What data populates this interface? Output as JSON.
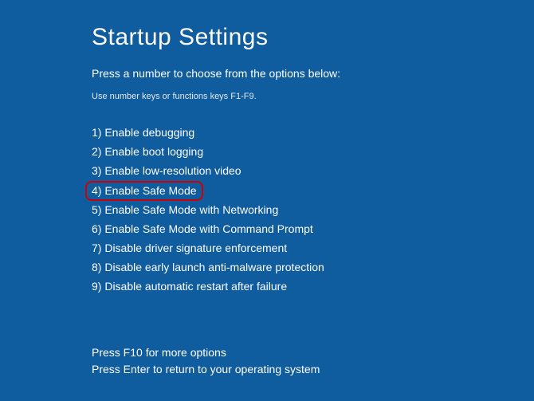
{
  "title": "Startup Settings",
  "subtitle": "Press a number to choose from the options below:",
  "hint": "Use number keys or functions keys F1-F9.",
  "options": [
    "1) Enable debugging",
    "2) Enable boot logging",
    "3) Enable low-resolution video",
    "4) Enable Safe Mode",
    "5) Enable Safe Mode with Networking",
    "6) Enable Safe Mode with Command Prompt",
    "7) Disable driver signature enforcement",
    "8) Disable early launch anti-malware protection",
    "9) Disable automatic restart after failure"
  ],
  "highlighted_index": 3,
  "footer": {
    "more_options": "Press F10 for more options",
    "return_text": "Press Enter to return to your operating system"
  }
}
